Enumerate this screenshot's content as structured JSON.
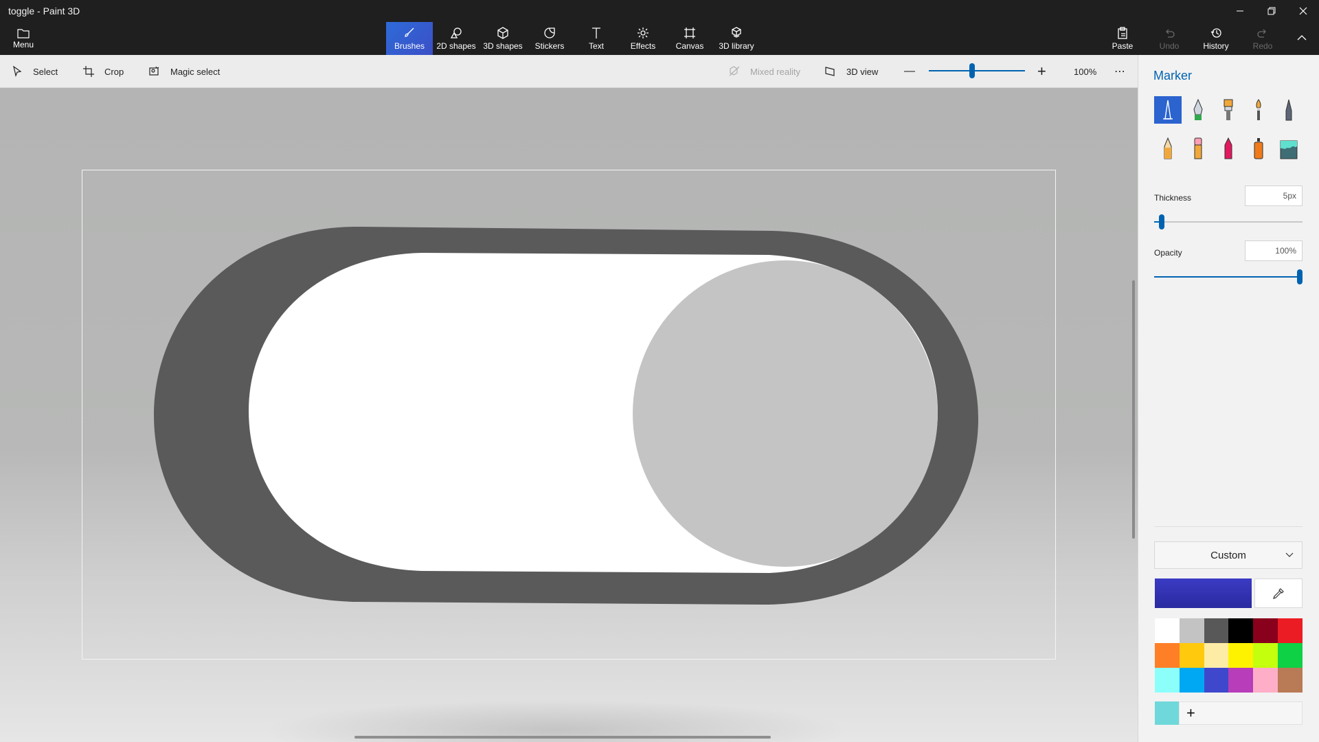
{
  "window": {
    "title": "toggle - Paint 3D"
  },
  "title_bar": {
    "minimize": "—",
    "maximize": "❐",
    "close": "✕"
  },
  "menu": {
    "label": "Menu"
  },
  "tabs": [
    {
      "label": "Brushes",
      "icon": "brush-icon",
      "active": true
    },
    {
      "label": "2D shapes",
      "icon": "2d-shapes-icon"
    },
    {
      "label": "3D shapes",
      "icon": "3d-shapes-icon"
    },
    {
      "label": "Stickers",
      "icon": "stickers-icon"
    },
    {
      "label": "Text",
      "icon": "text-icon"
    },
    {
      "label": "Effects",
      "icon": "effects-icon"
    },
    {
      "label": "Canvas",
      "icon": "canvas-icon"
    },
    {
      "label": "3D library",
      "icon": "3d-library-icon"
    }
  ],
  "right_actions": [
    {
      "label": "Paste",
      "icon": "paste-icon"
    },
    {
      "label": "Undo",
      "icon": "undo-icon",
      "disabled": true
    },
    {
      "label": "History",
      "icon": "history-icon"
    },
    {
      "label": "Redo",
      "icon": "redo-icon",
      "disabled": true
    }
  ],
  "subtoolbar": {
    "select": "Select",
    "crop": "Crop",
    "magic_select": "Magic select",
    "mixed_reality": "Mixed reality",
    "view_3d": "3D view",
    "zoom_out": "—",
    "zoom_in": "+",
    "zoom_level": "100%",
    "more": "⋯",
    "zoom_fraction": 0.45
  },
  "panel": {
    "title": "Marker",
    "brushes": [
      "marker",
      "calligraphy-pen",
      "oil-brush",
      "watercolor",
      "pixel-pen",
      "pencil",
      "eraser",
      "crayon",
      "spray-can",
      "fill"
    ],
    "thickness": {
      "label": "Thickness",
      "value": "5px",
      "fraction": 0.05
    },
    "opacity": {
      "label": "Opacity",
      "value": "100%",
      "fraction": 1.0
    },
    "color_mode": "Custom",
    "current_color": "#3b3bc4",
    "palette": [
      "#ffffff",
      "#c3c3c3",
      "#585858",
      "#000000",
      "#88001b",
      "#ec1c24",
      "#ff7f27",
      "#ffc90e",
      "#fdeca6",
      "#fff200",
      "#c4ff0e",
      "#0ed145",
      "#8cfffb",
      "#00a8f3",
      "#3f48cc",
      "#b83dba",
      "#ffaec8",
      "#b97a56"
    ],
    "custom_color": "#6fd8da",
    "add_color": "+"
  },
  "canvas": {
    "toggle": {
      "track_color": "#5a5a5a",
      "inner_color": "#ffffff",
      "knob_color": "#c4c4c4",
      "background": "#b4b4b4"
    }
  }
}
